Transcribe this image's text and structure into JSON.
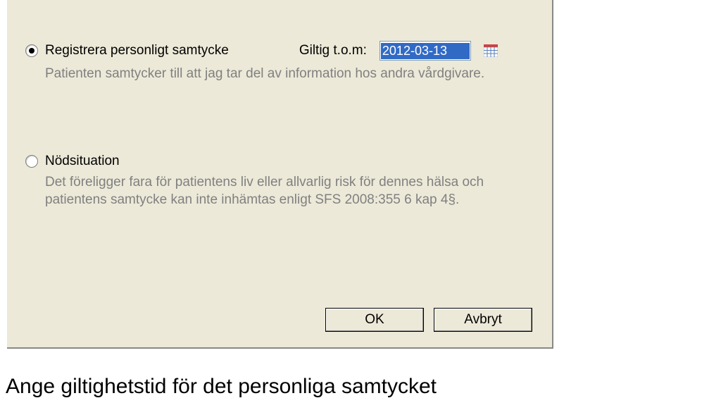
{
  "option1": {
    "label": "Registrera personligt samtycke",
    "desc": "Patienten samtycker till att jag tar del av information hos andra vårdgivare.",
    "valid_label": "Giltig t.o.m:",
    "date_value": "2012-03-13"
  },
  "option2": {
    "label": "Nödsituation",
    "desc": "Det föreligger fara för patientens liv eller allvarlig risk för dennes hälsa och patientens samtycke kan inte inhämtas enligt SFS 2008:355 6 kap 4§."
  },
  "buttons": {
    "ok": "OK",
    "cancel": "Avbryt"
  },
  "caption": "Ange giltighetstid för det personliga samtycket"
}
